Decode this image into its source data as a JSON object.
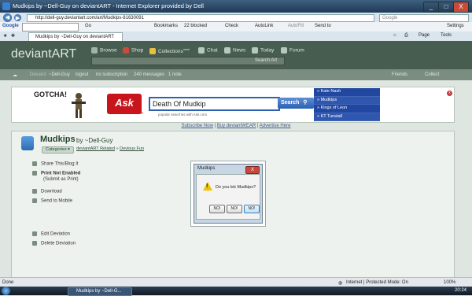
{
  "window": {
    "title": "Mudkips by ~Dell-Guy on deviantART - Internet Explorer provided by Dell",
    "minimize": "_",
    "maximize": "□",
    "close": "X"
  },
  "address_bar": {
    "url": "http://dell-guy.deviantart.com/art/Mudkips-81630091",
    "search_placeholder": "Google"
  },
  "google_toolbar": {
    "brand": "Google",
    "go": "Go",
    "bookmarks": "Bookmarks",
    "blocked": "22 blocked",
    "check": "Check",
    "autolink": "AutoLink",
    "autofill": "AutoFill",
    "send_to": "Send to",
    "settings": "Settings"
  },
  "tabs": {
    "active_tab": "Mudkips by ~Dell-Guy on deviantART",
    "page_menu": "Page",
    "tools_menu": "Tools"
  },
  "deviantart": {
    "logo": "deviantART",
    "nav": [
      "Browse",
      "Shop",
      "Collections",
      "Chat",
      "News",
      "Today",
      "Forum"
    ],
    "collections_badge": "new!",
    "search_button": "Search Art",
    "user": {
      "deviant": "Deviant",
      "username": "~Dell-Guy",
      "logout": "logout",
      "subscription": "no subscription",
      "messages": "240 messages",
      "notes": "1 note",
      "friends": "Friends",
      "collect": "Collect"
    }
  },
  "ad": {
    "gotcha": "GOTCHA!",
    "ask_logo": "Ask",
    "ask_com": ".com",
    "query": "Death Of Mudkip",
    "search_button": "Search",
    "hint": "popular searches with Ask.com",
    "trending": [
      "Kate Nash",
      "Mudkips",
      "Kings of Leon",
      "KT Tunstall"
    ],
    "close": "x",
    "links": [
      "Subscribe Now",
      "Buy deviantWEAR",
      "Advertise Here"
    ],
    "separator": "|"
  },
  "deviation": {
    "title": "Mudkips",
    "by": "by ~Dell-Guy",
    "categories_button": "Categories",
    "path": [
      "deviantART Related",
      "Devious Fun"
    ],
    "path_separator": "»",
    "actions": [
      "Share This/Blog It",
      "Print Not Enabled",
      "(Submit as Print)",
      "Download",
      "Send to Mobile",
      "Edit Deviation",
      "Delete Deviation"
    ]
  },
  "dialog": {
    "title": "Mudkips",
    "close": "X",
    "message": "Do you lek Mudkips?",
    "buttons": [
      "NO!",
      "NO!",
      "NO!"
    ]
  },
  "status_bar": {
    "status": "Done",
    "zone": "Internet | Protected Mode: On",
    "zoom": "100%"
  },
  "taskbar": {
    "task": "Mudkips by ~Dell-G...",
    "clock": "20:24"
  }
}
